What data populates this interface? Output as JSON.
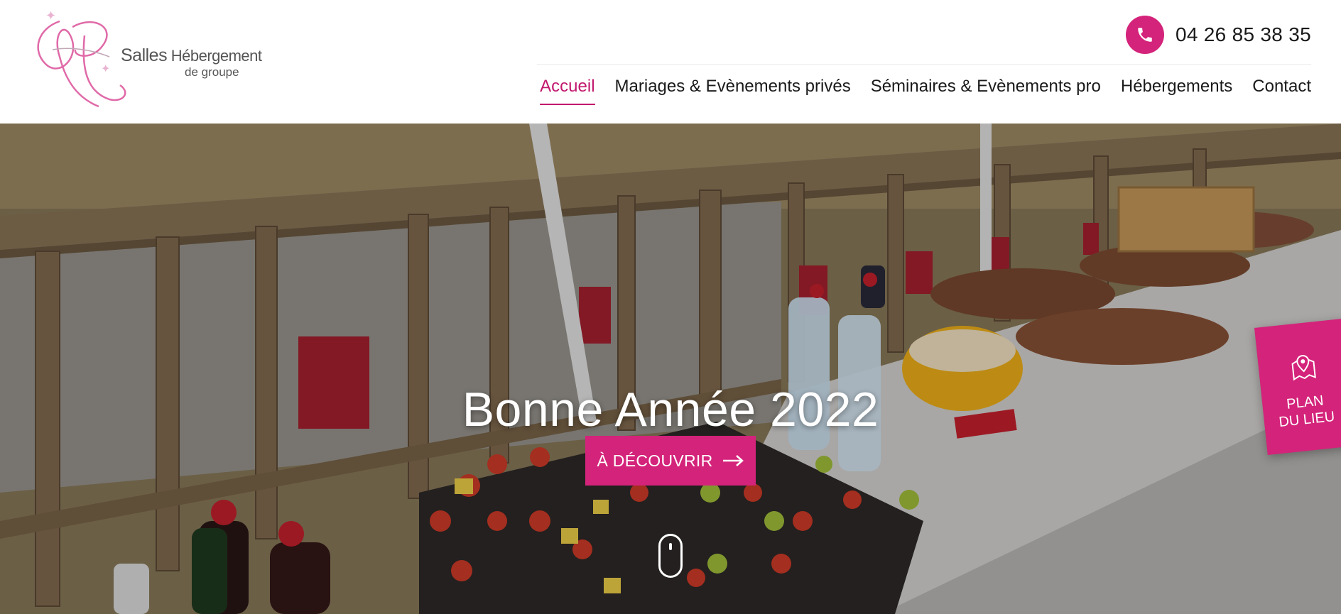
{
  "header": {
    "logo": {
      "monogram": "LP",
      "line1": "Salles",
      "line1b": "Hébergement",
      "line2": "de groupe"
    },
    "phone": {
      "icon": "phone-icon",
      "number": "04 26 85 38 35"
    },
    "nav": {
      "items": [
        {
          "label": "Accueil",
          "active": true
        },
        {
          "label": "Mariages & Evènements privés",
          "active": false
        },
        {
          "label": "Séminaires & Evènements pro",
          "active": false
        },
        {
          "label": "Hébergements",
          "active": false
        },
        {
          "label": "Contact",
          "active": false
        }
      ]
    }
  },
  "hero": {
    "title": "Bonne Année 2022",
    "cta": {
      "label": "À DÉCOUVRIR",
      "icon": "arrow-right-icon"
    },
    "scroll_icon": "mouse-scroll-icon"
  },
  "plan_badge": {
    "icon": "map-pin-icon",
    "line1": "PLAN",
    "line2": "DU LIEU"
  },
  "colors": {
    "accent": "#d4237a",
    "accent_text": "#c2186e"
  }
}
